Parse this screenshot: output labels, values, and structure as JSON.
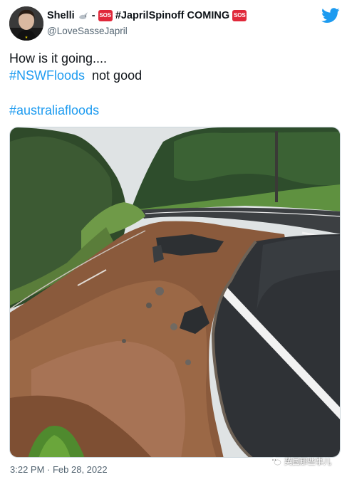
{
  "header": {
    "display_name": "Shelli",
    "separator": "-",
    "sos_badge": "SOS",
    "display_name_suffix": "#JaprilSpinoff COMING",
    "handle": "@LoveSasseJapril"
  },
  "tweet": {
    "line1": "How is it going....",
    "hashtag1": "#NSWFloods",
    "line2_rest": "  not good",
    "hashtag2": "#australiafloods"
  },
  "footer": {
    "timestamp": "3:22 PM · Feb 28, 2022"
  },
  "watermark": {
    "text": "英国那些事儿"
  },
  "colors": {
    "link": "#1d9bf0",
    "twitter_brand": "#1d9bf0",
    "sos_red": "#e0283a",
    "muted_text": "#536471"
  },
  "icons": {
    "brand": "twitter-bird-icon",
    "name_emoji_1": "dove-icon",
    "name_emoji_2": "sos-icon",
    "watermark": "wechat-icon"
  }
}
